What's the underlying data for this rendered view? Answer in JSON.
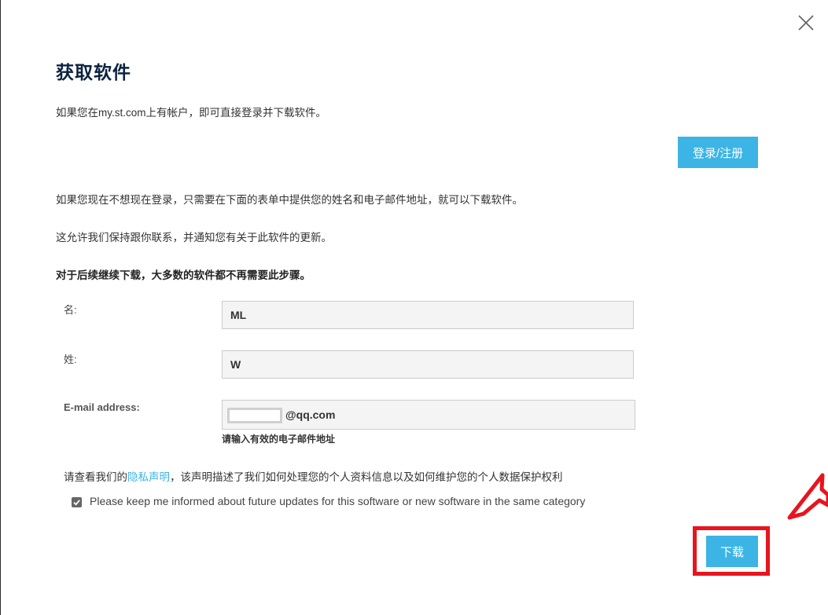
{
  "dialog": {
    "title": "获取软件",
    "intro": "如果您在my.st.com上有帐户，即可直接登录并下载软件。",
    "login_button": "登录/注册",
    "para_no_login": "如果您现在不想现在登录，只需要在下面的表单中提供您的姓名和电子邮件地址，就可以下载软件。",
    "para_contact": "这允许我们保持跟你联系，并通知您有关于此软件的更新。",
    "para_bold": "对于后续继续下载，大多数的软件都不再需要此步骤。"
  },
  "form": {
    "first_name_label": "名:",
    "first_name_value": "ML",
    "last_name_label": "姓:",
    "last_name_value": "W",
    "email_label": "E-mail address:",
    "email_value": "@qq.com",
    "email_hint": "请输入有效的电子邮件地址"
  },
  "privacy": {
    "prefix": "请查看我们的",
    "link": "隐私声明",
    "suffix": "，该声明描述了我们如何处理您的个人资料信息以及如何维护您的个人数据保护权利"
  },
  "updates_checkbox": {
    "checked": true,
    "label": "Please keep me informed about future updates for this software or new software in the same category"
  },
  "download_button": "下载",
  "colors": {
    "accent": "#3cb4e5",
    "title": "#0b2240",
    "annotation_red": "#e8141e"
  },
  "icons": {
    "close": "close-icon",
    "check": "checkmark-icon",
    "annotation": "arrow-annotation"
  }
}
